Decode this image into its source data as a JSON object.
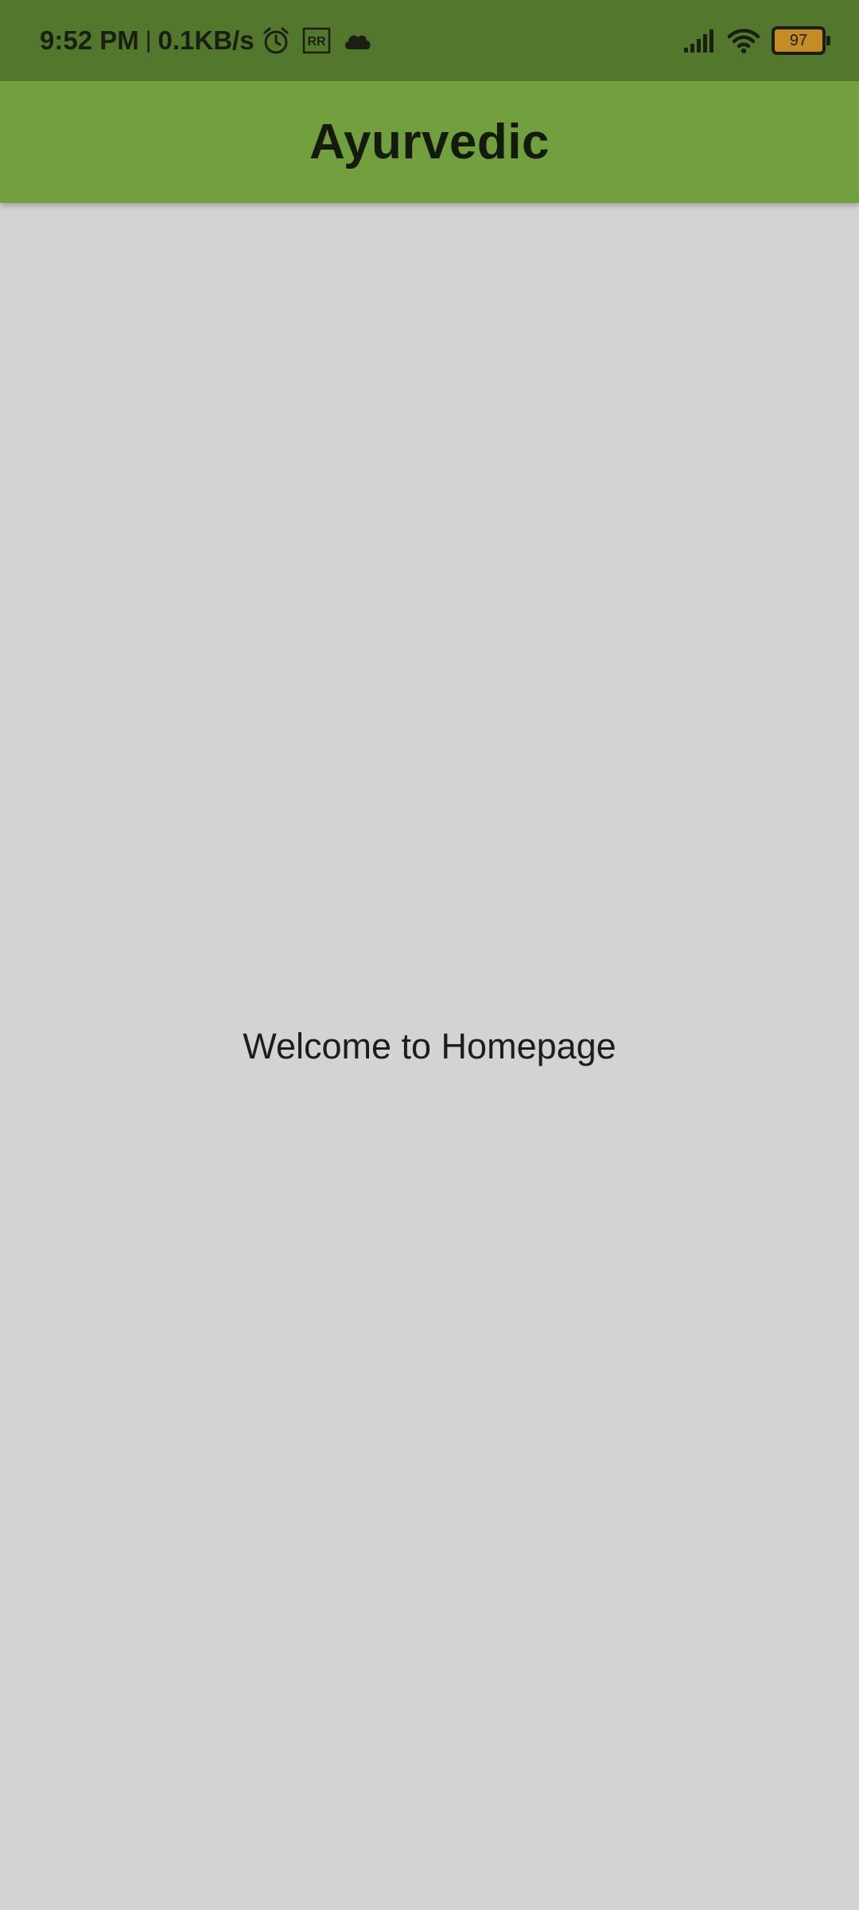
{
  "status_bar": {
    "time": "9:52 PM",
    "separator": "|",
    "network_speed": "0.1KB/s",
    "icons_left": [
      "alarm-icon",
      "rr-icon",
      "cloud-icon"
    ],
    "icons_right": [
      "signal-icon",
      "wifi-icon",
      "battery-icon"
    ],
    "battery_level": "97",
    "colors": {
      "background": "#54772e",
      "battery_fill": "#c58b26"
    }
  },
  "app_bar": {
    "title": "Ayurvedic",
    "color": "#72a03e"
  },
  "main": {
    "welcome_text": "Welcome to Homepage",
    "background": "#d3d3d3"
  }
}
